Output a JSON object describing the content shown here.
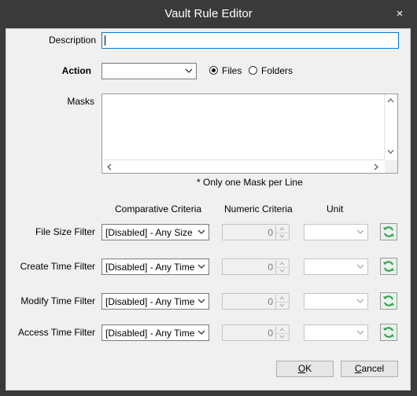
{
  "window": {
    "title": "Vault Rule Editor",
    "close_symbol": "×"
  },
  "description": {
    "label": "Description",
    "value": ""
  },
  "action": {
    "label": "Action",
    "value": "",
    "radio_files": "Files",
    "radio_folders": "Folders",
    "selected": "Files"
  },
  "masks": {
    "label": "Masks",
    "value": "",
    "note": "* Only one Mask per Line"
  },
  "headers": {
    "criteria": "Comparative Criteria",
    "numeric": "Numeric Criteria",
    "unit": "Unit"
  },
  "filters": [
    {
      "label": "File Size Filter",
      "criteria": "[Disabled] - Any Size",
      "numeric": "0",
      "unit": ""
    },
    {
      "label": "Create Time Filter",
      "criteria": "[Disabled] - Any Time",
      "numeric": "0",
      "unit": ""
    },
    {
      "label": "Modify Time Filter",
      "criteria": "[Disabled] - Any Time",
      "numeric": "0",
      "unit": ""
    },
    {
      "label": "Access Time Filter",
      "criteria": "[Disabled] - Any Time",
      "numeric": "0",
      "unit": ""
    }
  ],
  "buttons": {
    "ok_first": "O",
    "ok_rest": "K",
    "cancel_first": "C",
    "cancel_rest": "ancel"
  },
  "colors": {
    "titlebar": "#3a3a3a",
    "client": "#f0f0f0",
    "focus_border": "#0078d7",
    "refresh_icon": "#2e9e4e"
  }
}
